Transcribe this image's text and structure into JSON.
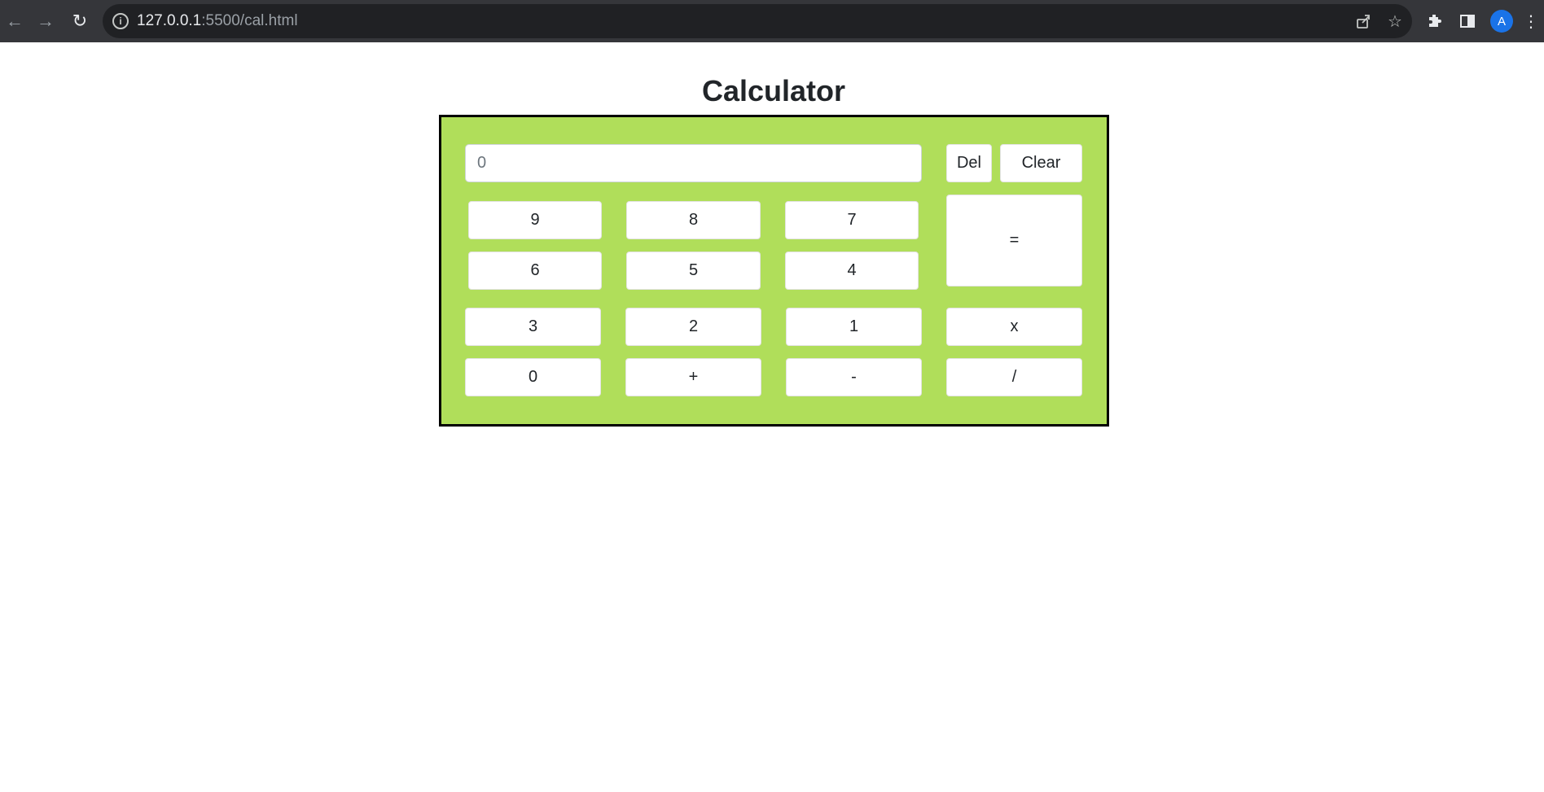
{
  "browser": {
    "url_host": "127.0.0.1",
    "url_path": ":5500/cal.html",
    "avatar_letter": "A",
    "icons": [
      "back-icon",
      "forward-icon",
      "reload-icon",
      "info-icon",
      "share-icon",
      "bookmark-star-icon",
      "extensions-icon",
      "side-panel-icon",
      "menu-icon"
    ]
  },
  "page": {
    "title": "Calculator"
  },
  "calculator": {
    "display_placeholder": "0",
    "background_color": "#b0de5a",
    "border_color": "#000000",
    "buttons": {
      "del": "Del",
      "clear": "Clear",
      "equals": "=",
      "nine": "9",
      "eight": "8",
      "seven": "7",
      "six": "6",
      "five": "5",
      "four": "4",
      "three": "3",
      "two": "2",
      "one": "1",
      "zero": "0",
      "plus": "+",
      "minus": "-",
      "multiply": "x",
      "divide": "/"
    }
  }
}
